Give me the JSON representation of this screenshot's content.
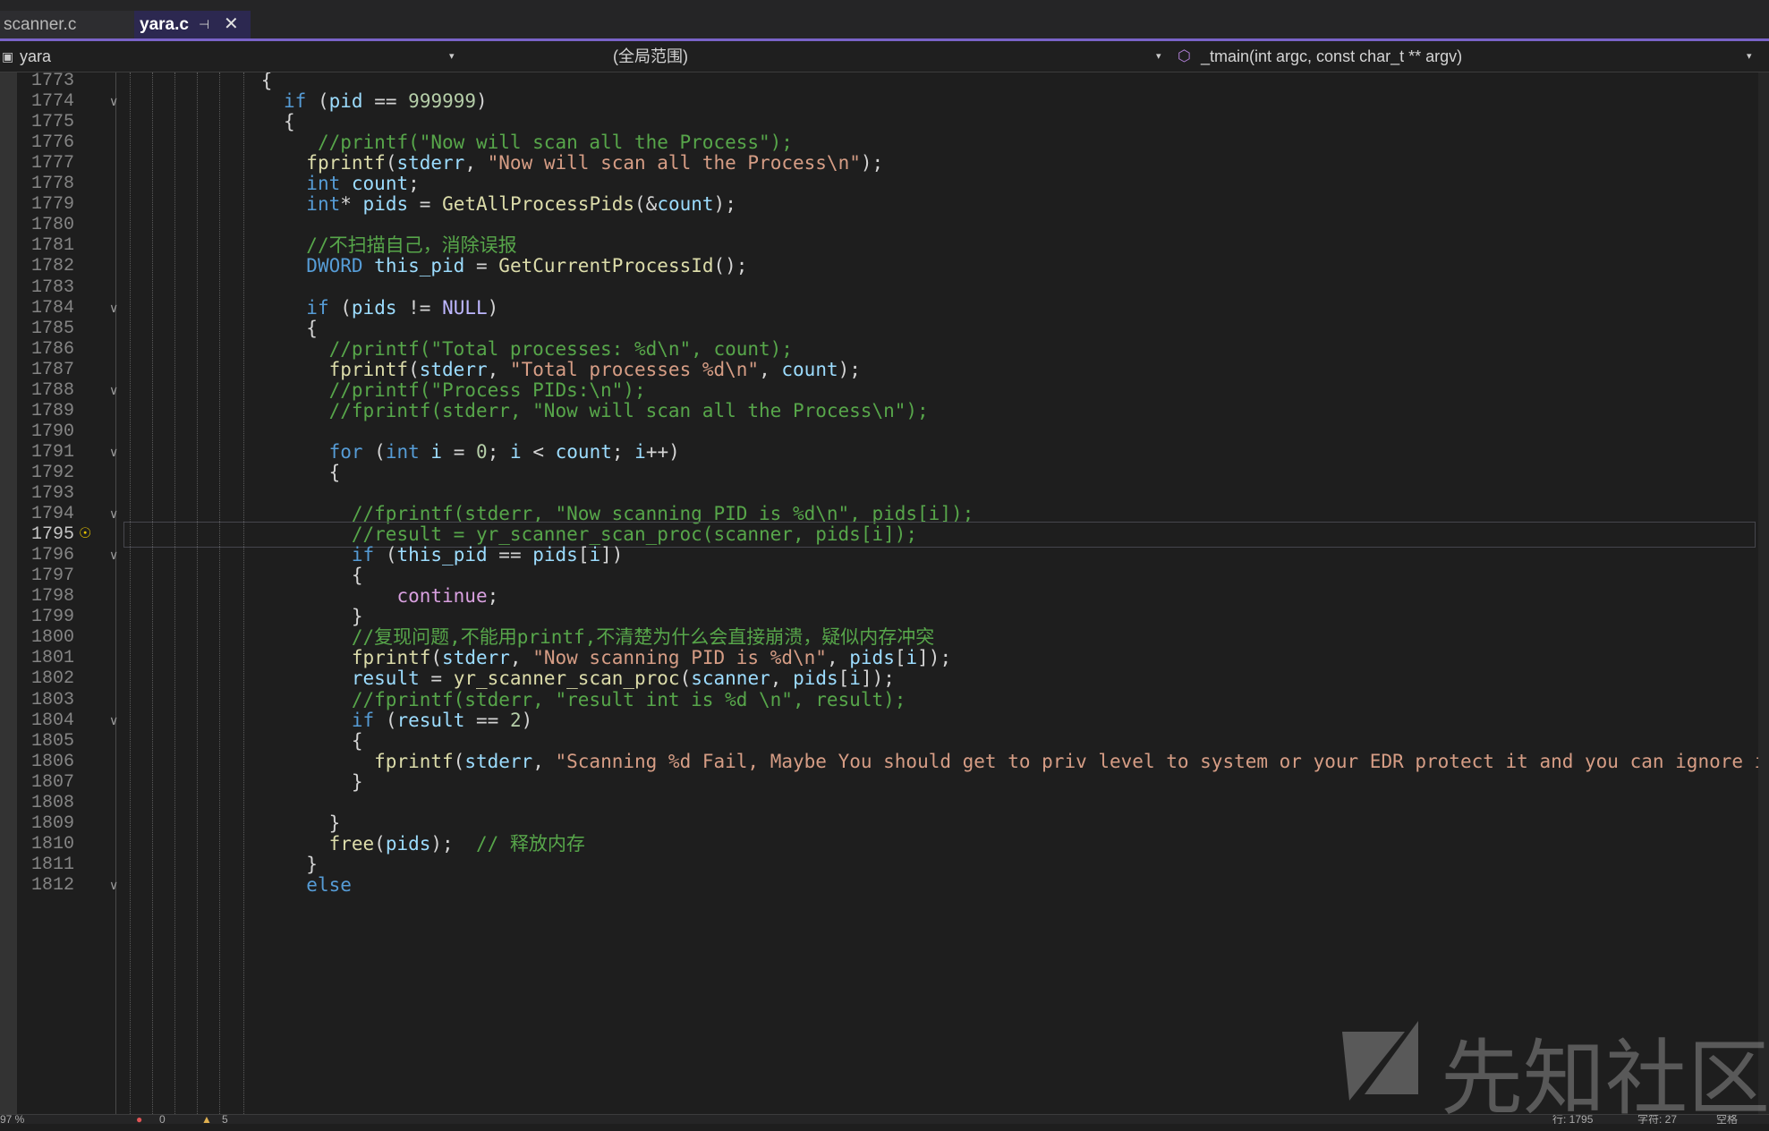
{
  "tabs": [
    {
      "label": "scanner.c",
      "active": false
    },
    {
      "label": "yara.c",
      "active": true
    }
  ],
  "tab_icons": {
    "pin": "pin-icon",
    "close": "close-icon"
  },
  "navbar": {
    "project": "yara",
    "scope": "(全局范围)",
    "function": "_tmain(int argc, const char_t ** argv)"
  },
  "editor": {
    "current_line": 1795,
    "lines": [
      {
        "num": "1773",
        "text": "            {"
      },
      {
        "num": "1774",
        "text": "              if (pid == 999999)"
      },
      {
        "num": "1775",
        "text": "              {"
      },
      {
        "num": "1776",
        "text": "                 //printf(\"Now will scan all the Process\");"
      },
      {
        "num": "1777",
        "text": "                fprintf(stderr, \"Now will scan all the Process\\n\");"
      },
      {
        "num": "1778",
        "text": "                int count;"
      },
      {
        "num": "1779",
        "text": "                int* pids = GetAllProcessPids(&count);"
      },
      {
        "num": "1780",
        "text": ""
      },
      {
        "num": "1781",
        "text": "                //不扫描自己，消除误报"
      },
      {
        "num": "1782",
        "text": "                DWORD this_pid = GetCurrentProcessId();"
      },
      {
        "num": "1783",
        "text": ""
      },
      {
        "num": "1784",
        "text": "                if (pids != NULL)"
      },
      {
        "num": "1785",
        "text": "                {"
      },
      {
        "num": "1786",
        "text": "                  //printf(\"Total processes: %d\\n\", count);"
      },
      {
        "num": "1787",
        "text": "                  fprintf(stderr, \"Total processes %d\\n\", count);"
      },
      {
        "num": "1788",
        "text": "                  //printf(\"Process PIDs:\\n\");"
      },
      {
        "num": "1789",
        "text": "                  //fprintf(stderr, \"Now will scan all the Process\\n\");"
      },
      {
        "num": "1790",
        "text": ""
      },
      {
        "num": "1791",
        "text": "                  for (int i = 0; i < count; i++)"
      },
      {
        "num": "1792",
        "text": "                  {"
      },
      {
        "num": "1793",
        "text": ""
      },
      {
        "num": "1794",
        "text": "                    //fprintf(stderr, \"Now scanning PID is %d\\n\", pids[i]);"
      },
      {
        "num": "1795",
        "text": "                    //result = yr_scanner_scan_proc(scanner, pids[i]);"
      },
      {
        "num": "1796",
        "text": "                    if (this_pid == pids[i])"
      },
      {
        "num": "1797",
        "text": "                    {"
      },
      {
        "num": "1798",
        "text": "                        continue;"
      },
      {
        "num": "1799",
        "text": "                    }"
      },
      {
        "num": "1800",
        "text": "                    //复现问题,不能用printf,不清楚为什么会直接崩溃，疑似内存冲突"
      },
      {
        "num": "1801",
        "text": "                    fprintf(stderr, \"Now scanning PID is %d\\n\", pids[i]);"
      },
      {
        "num": "1802",
        "text": "                    result = yr_scanner_scan_proc(scanner, pids[i]);"
      },
      {
        "num": "1803",
        "text": "                    //fprintf(stderr, \"result int is %d \\n\", result);"
      },
      {
        "num": "1804",
        "text": "                    if (result == 2)"
      },
      {
        "num": "1805",
        "text": "                    {"
      },
      {
        "num": "1806",
        "text": "                      fprintf(stderr, \"Scanning %d Fail, Maybe You should get to priv level to system or your EDR protect it and you can ignore it \\n"
      },
      {
        "num": "1807",
        "text": "                    }"
      },
      {
        "num": "1808",
        "text": ""
      },
      {
        "num": "1809",
        "text": "                  }"
      },
      {
        "num": "1810",
        "text": "                  free(pids);  // 释放内存"
      },
      {
        "num": "1811",
        "text": "                }"
      },
      {
        "num": "1812",
        "text": "                else"
      }
    ]
  },
  "statusbar": {
    "zoom": "97 %",
    "errors": "0",
    "warnings": "5",
    "position_row": "行: 1795",
    "position_col": "字符: 27",
    "indent_mode": "空格"
  },
  "watermark": "先知社区",
  "colors": {
    "accent": "#7a63c8",
    "keyword": "#569cd6",
    "comment": "#57a64a",
    "string": "#d69d85",
    "function": "#dcdcaa",
    "variable": "#9cdcfe",
    "macro": "#beb7ff"
  }
}
